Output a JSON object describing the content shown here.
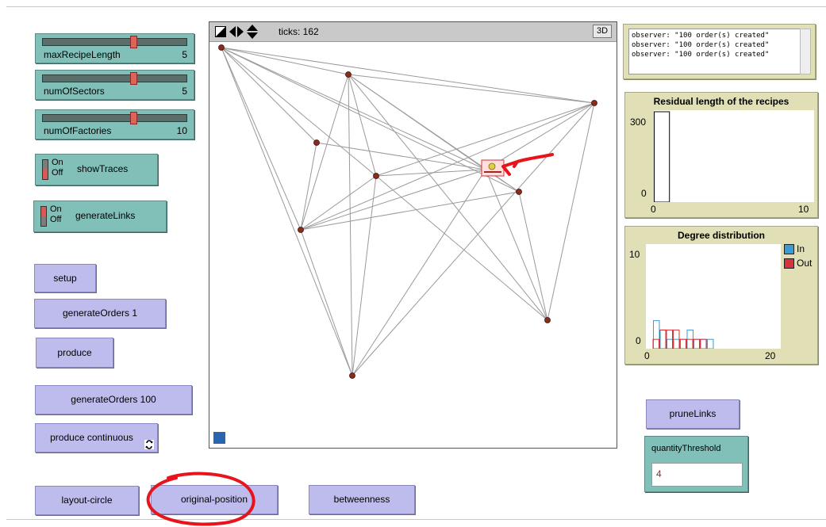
{
  "sliders": [
    {
      "label": "maxRecipeLength",
      "value": "5",
      "fraction": 0.64
    },
    {
      "label": "numOfSectors",
      "value": "5",
      "fraction": 0.64
    },
    {
      "label": "numOfFactories",
      "value": "10",
      "fraction": 0.64
    }
  ],
  "switches": [
    {
      "label": "showTraces",
      "on": "On",
      "off": "Off",
      "state": "off"
    },
    {
      "label": "generateLinks",
      "on": "On",
      "off": "Off",
      "state": "on"
    }
  ],
  "buttons": {
    "setup": "setup",
    "generate_orders_1": "generateOrders 1",
    "produce": "produce",
    "generate_orders_100": "generateOrders 100",
    "produce_continuous": "produce continuous",
    "layout_circle": "layout-circle",
    "original_position": "original-position",
    "betweenness": "betweenness",
    "prune_links": "pruneLinks"
  },
  "world": {
    "ticks_label": "ticks: 162",
    "three_d_label": "3D"
  },
  "output": {
    "lines": [
      "observer: \"100 order(s) created\"",
      "observer: \"100 order(s) created\"",
      "observer: \"100 order(s) created\""
    ]
  },
  "quantity_threshold": {
    "label": "quantityThreshold",
    "value": "4"
  },
  "colors": {
    "button": "#bdbcec",
    "slider": "#80c0b8",
    "plot_bg": "#e0dfb6",
    "in_series": "#3a9bd0",
    "out_series": "#d8333a",
    "annotation": "#e8141c"
  },
  "chart_data": [
    {
      "type": "bar",
      "title": "Residual length of the recipes",
      "xlim": [
        0,
        10
      ],
      "ylim": [
        0,
        300
      ],
      "x_ticks": [
        "0",
        "10"
      ],
      "y_ticks": [
        "0",
        "300"
      ],
      "series": [
        {
          "values": [
            {
              "x": 0,
              "y": 300
            }
          ]
        }
      ]
    },
    {
      "type": "bar",
      "title": "Degree distribution",
      "xlim": [
        0,
        20
      ],
      "ylim": [
        0,
        10
      ],
      "x_ticks": [
        "0",
        "20"
      ],
      "y_ticks": [
        "0",
        "10"
      ],
      "legend": "top-right",
      "bin_width": 1,
      "series": [
        {
          "name": "In",
          "color": "#3a9bd0",
          "values": [
            {
              "x": 1,
              "y": 3
            },
            {
              "x": 2,
              "y": 2
            },
            {
              "x": 3,
              "y": 1
            },
            {
              "x": 4,
              "y": 1
            },
            {
              "x": 5,
              "y": 1
            },
            {
              "x": 6,
              "y": 2
            },
            {
              "x": 7,
              "y": 1
            },
            {
              "x": 8,
              "y": 1
            },
            {
              "x": 9,
              "y": 1
            }
          ]
        },
        {
          "name": "Out",
          "color": "#d8333a",
          "values": [
            {
              "x": 1,
              "y": 1
            },
            {
              "x": 2,
              "y": 2
            },
            {
              "x": 3,
              "y": 2
            },
            {
              "x": 4,
              "y": 2
            },
            {
              "x": 5,
              "y": 1
            },
            {
              "x": 6,
              "y": 1
            },
            {
              "x": 7,
              "y": 1
            },
            {
              "x": 8,
              "y": 1
            }
          ]
        }
      ]
    }
  ]
}
